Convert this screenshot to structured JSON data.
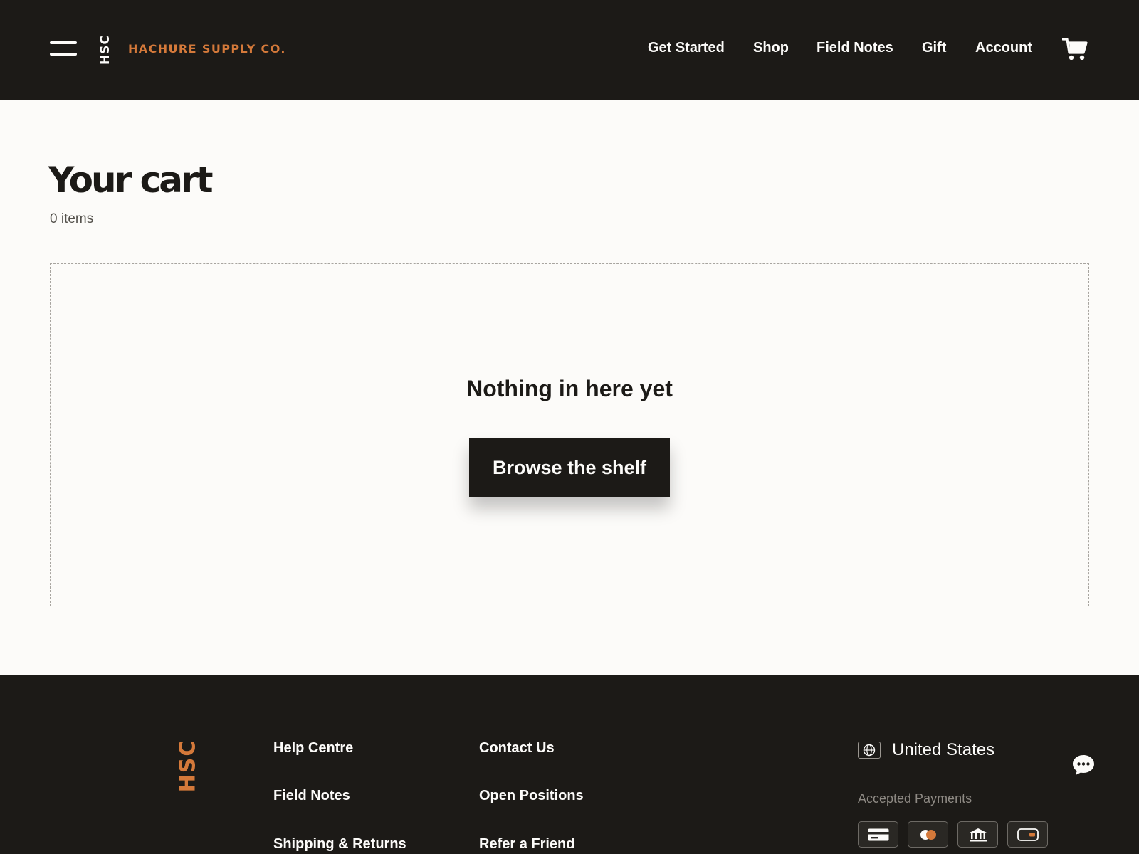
{
  "header": {
    "logo_mark": "HSC",
    "brand_name": "HACHURE SUPPLY CO.",
    "nav": [
      "Get Started",
      "Shop",
      "Field Notes",
      "Gift",
      "Account"
    ]
  },
  "main": {
    "title": "Your cart",
    "item_count": "0 items",
    "empty_heading": "Nothing in here yet",
    "cta_label": "Browse the shelf"
  },
  "footer": {
    "logo_mark": "HSC",
    "links_col1": [
      "Help Centre",
      "Field Notes",
      "Shipping & Returns"
    ],
    "links_col2": [
      "Contact Us",
      "Open Positions",
      "Refer a Friend"
    ],
    "region": "United States",
    "payments_label": "Accepted Payments",
    "payment_icons": [
      "credit-card-icon",
      "mastercard-icon",
      "bank-icon",
      "wallet-icon"
    ]
  },
  "colors": {
    "dark": "#1c1a17",
    "accent": "#d4793a",
    "background": "#fcfbf9"
  }
}
